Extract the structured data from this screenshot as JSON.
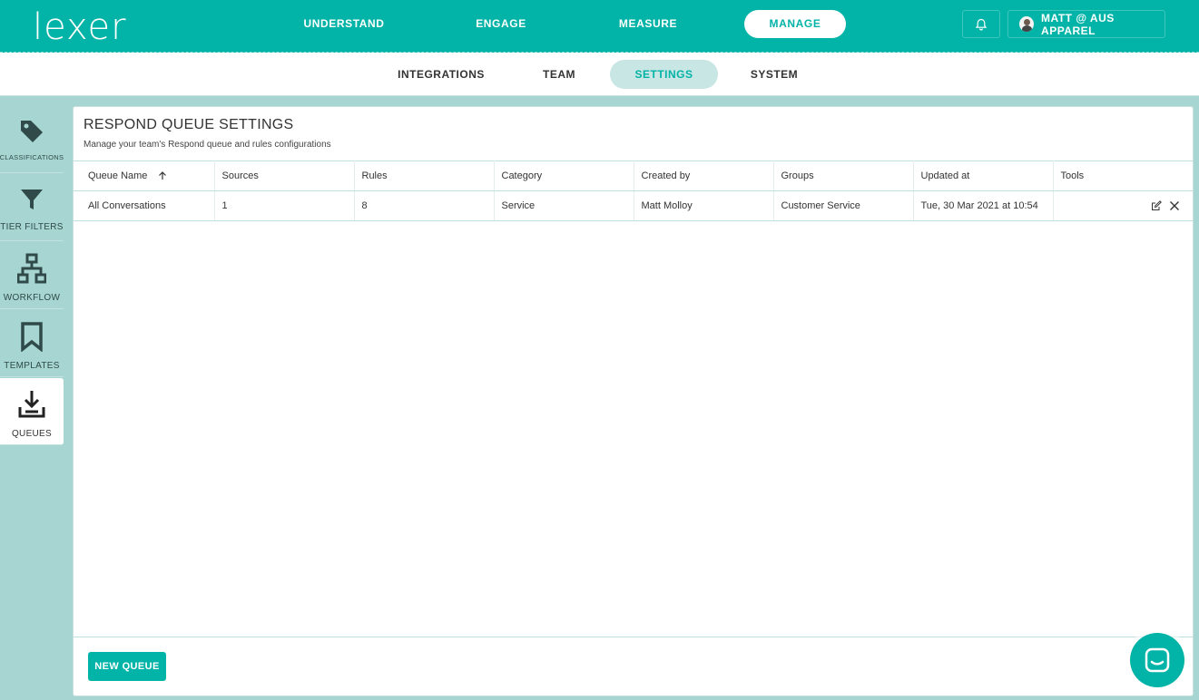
{
  "brand": {
    "logo_text": "lexer"
  },
  "top_nav": {
    "items": [
      {
        "label": "UNDERSTAND"
      },
      {
        "label": "ENGAGE"
      },
      {
        "label": "MEASURE"
      },
      {
        "label": "MANAGE"
      }
    ],
    "active": "MANAGE",
    "account_label": "MATT @ AUS APPAREL"
  },
  "sub_nav": {
    "items": [
      {
        "label": "INTEGRATIONS"
      },
      {
        "label": "TEAM"
      },
      {
        "label": "SETTINGS"
      },
      {
        "label": "SYSTEM"
      }
    ],
    "active": "SETTINGS"
  },
  "sidebar": {
    "items": [
      {
        "label": "CLASSIFICATIONS",
        "icon": "tag-icon"
      },
      {
        "label": "TIER FILTERS",
        "icon": "filter-icon"
      },
      {
        "label": "WORKFLOW",
        "icon": "workflow-icon"
      },
      {
        "label": "TEMPLATES",
        "icon": "bookmark-icon"
      },
      {
        "label": "QUEUES",
        "icon": "download-tray-icon"
      }
    ],
    "active": "QUEUES"
  },
  "panel": {
    "title": "RESPOND QUEUE SETTINGS",
    "subtitle": "Manage your team's Respond queue and rules configurations"
  },
  "table": {
    "columns": [
      "Queue Name",
      "Sources",
      "Rules",
      "Category",
      "Created by",
      "Groups",
      "Updated at",
      "Tools"
    ],
    "sort_column": "Queue Name",
    "sort_direction": "ascending",
    "rows": [
      [
        "All Conversations",
        "1",
        "8",
        "Service",
        "Matt Molloy",
        "Customer Service",
        "Tue, 30 Mar 2021 at 10:54"
      ]
    ]
  },
  "actions": {
    "new_queue_label": "NEW QUEUE"
  },
  "colors": {
    "brand_teal": "#02b3a7",
    "sidebar_bg": "#a7d6d2",
    "active_subnav_bg": "#c8e6e3"
  }
}
